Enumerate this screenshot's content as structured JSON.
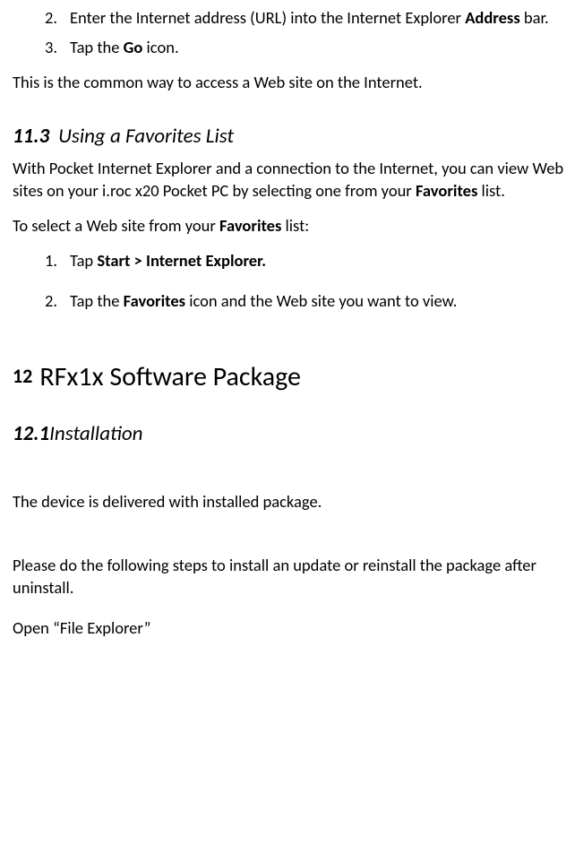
{
  "steps_top": [
    {
      "num": "2.",
      "pre": "Enter the Internet address (URL) into the Internet Explorer ",
      "bold": "Address",
      "post": " bar."
    },
    {
      "num": "3.",
      "pre": "Tap the ",
      "bold": "Go",
      "post": " icon."
    }
  ],
  "para_common": "This is the common way to access a Web site on the Internet.",
  "sec_11_3": {
    "num": "11.3",
    "title": "Using a Favorites List",
    "intro": {
      "pre": "With Pocket Internet Explorer and a connection to the Internet, you can view Web sites on your i.roc x20 Pocket PC by selecting one from your ",
      "bold": "Favorites",
      "post": " list."
    },
    "select_line": {
      "pre": "To select a Web site from your ",
      "bold": "Favorites",
      "post": " list:"
    },
    "steps": [
      {
        "num": "1.",
        "pre": "Tap ",
        "bold": "Start > Internet Explorer.",
        "post": ""
      },
      {
        "num": "2.",
        "pre": "Tap the ",
        "bold": "Favorites",
        "post": " icon and the Web site you want to view."
      }
    ]
  },
  "sec_12": {
    "num": "12",
    "title": "RFx1x Software Package"
  },
  "sec_12_1": {
    "num": "12.1",
    "title": "Installation",
    "delivered": "The device is delivered with installed package.",
    "please": "Please do the following steps to install an update or reinstall the package after uninstall.",
    "open": "Open “File Explorer”"
  }
}
